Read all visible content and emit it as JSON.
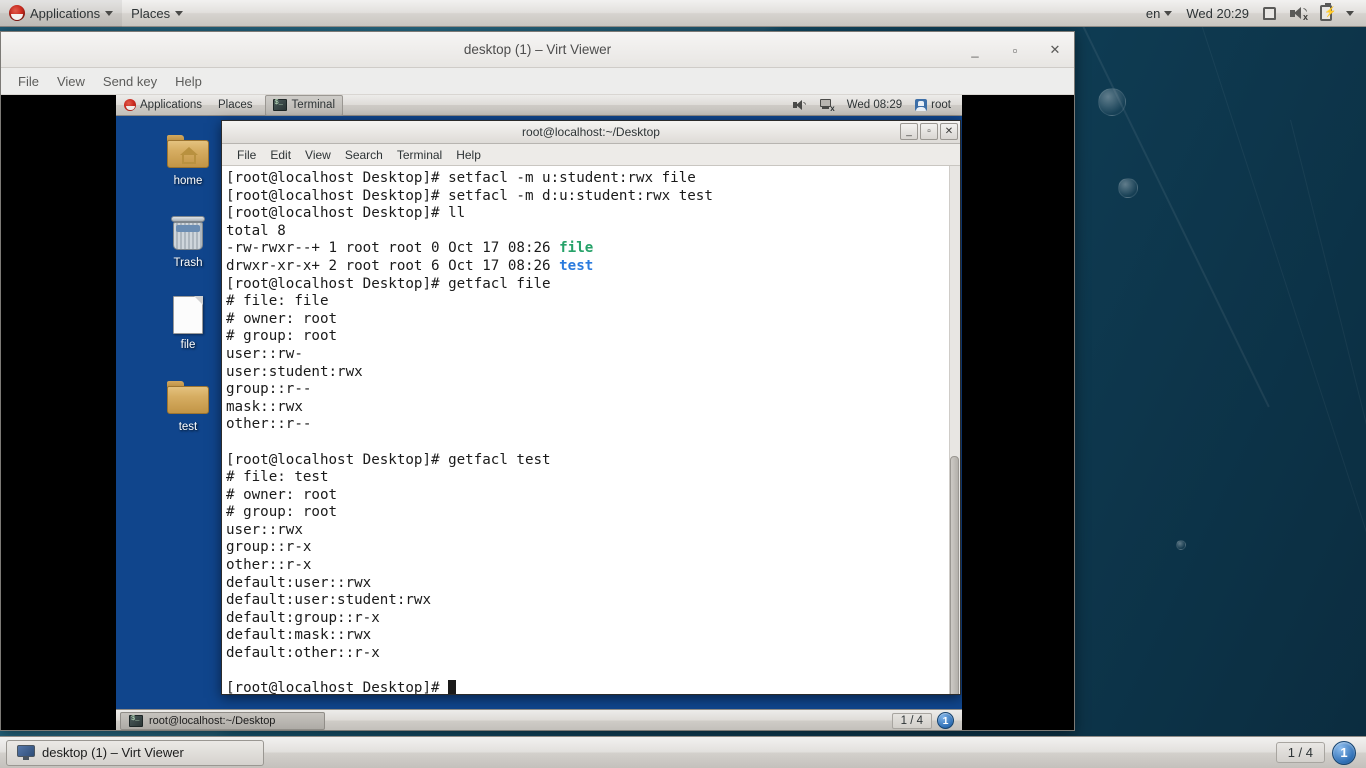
{
  "host": {
    "top_panel": {
      "applications_label": "Applications",
      "places_label": "Places",
      "keyboard_layout": "en",
      "clock": "Wed 20:29",
      "icons": [
        "screen-icon",
        "speaker-muted-icon",
        "battery-icon",
        "caret-down-icon"
      ]
    },
    "bottom_panel": {
      "task_label": "desktop (1) – Virt Viewer",
      "workspace_count": "1 / 4",
      "workspace_current": "1"
    }
  },
  "virt_viewer": {
    "title": "desktop (1) – Virt Viewer",
    "window_buttons": {
      "minimize": "_",
      "maximize": "▫",
      "close": "✕"
    },
    "menus": [
      "File",
      "View",
      "Send key",
      "Help"
    ]
  },
  "guest": {
    "top_panel": {
      "applications_label": "Applications",
      "places_label": "Places",
      "window_task": "Terminal",
      "clock": "Wed 08:29",
      "user": "root"
    },
    "desktop_icons": [
      {
        "name": "home",
        "label": "home",
        "icon": "home-folder-icon"
      },
      {
        "name": "trash",
        "label": "Trash",
        "icon": "trash-icon"
      },
      {
        "name": "file",
        "label": "file",
        "icon": "document-icon"
      },
      {
        "name": "test",
        "label": "test",
        "icon": "folder-icon"
      }
    ],
    "bottom_panel": {
      "task_label": "root@localhost:~/Desktop",
      "workspace_count": "1 / 4",
      "workspace_current": "1"
    }
  },
  "terminal": {
    "title": "root@localhost:~/Desktop",
    "window_buttons": {
      "minimize": "_",
      "maximize": "▫",
      "close": "✕"
    },
    "menus": [
      "File",
      "Edit",
      "View",
      "Search",
      "Terminal",
      "Help"
    ],
    "prompt": "[root@localhost Desktop]# ",
    "lines": [
      {
        "segments": [
          {
            "text": "[root@localhost Desktop]# setfacl -m u:student:rwx file"
          }
        ]
      },
      {
        "segments": [
          {
            "text": "[root@localhost Desktop]# setfacl -m d:u:student:rwx test"
          }
        ]
      },
      {
        "segments": [
          {
            "text": "[root@localhost Desktop]# ll"
          }
        ]
      },
      {
        "segments": [
          {
            "text": "total 8"
          }
        ]
      },
      {
        "segments": [
          {
            "text": "-rw-rwxr--+ 1 root root 0 Oct 17 08:26 "
          },
          {
            "text": "file",
            "color": "green"
          }
        ]
      },
      {
        "segments": [
          {
            "text": "drwxr-xr-x+ 2 root root 6 Oct 17 08:26 "
          },
          {
            "text": "test",
            "color": "blue"
          }
        ]
      },
      {
        "segments": [
          {
            "text": "[root@localhost Desktop]# getfacl file"
          }
        ]
      },
      {
        "segments": [
          {
            "text": "# file: file"
          }
        ]
      },
      {
        "segments": [
          {
            "text": "# owner: root"
          }
        ]
      },
      {
        "segments": [
          {
            "text": "# group: root"
          }
        ]
      },
      {
        "segments": [
          {
            "text": "user::rw-"
          }
        ]
      },
      {
        "segments": [
          {
            "text": "user:student:rwx"
          }
        ]
      },
      {
        "segments": [
          {
            "text": "group::r--"
          }
        ]
      },
      {
        "segments": [
          {
            "text": "mask::rwx"
          }
        ]
      },
      {
        "segments": [
          {
            "text": "other::r--"
          }
        ]
      },
      {
        "segments": [
          {
            "text": ""
          }
        ]
      },
      {
        "segments": [
          {
            "text": "[root@localhost Desktop]# getfacl test"
          }
        ]
      },
      {
        "segments": [
          {
            "text": "# file: test"
          }
        ]
      },
      {
        "segments": [
          {
            "text": "# owner: root"
          }
        ]
      },
      {
        "segments": [
          {
            "text": "# group: root"
          }
        ]
      },
      {
        "segments": [
          {
            "text": "user::rwx"
          }
        ]
      },
      {
        "segments": [
          {
            "text": "group::r-x"
          }
        ]
      },
      {
        "segments": [
          {
            "text": "other::r-x"
          }
        ]
      },
      {
        "segments": [
          {
            "text": "default:user::rwx"
          }
        ]
      },
      {
        "segments": [
          {
            "text": "default:user:student:rwx"
          }
        ]
      },
      {
        "segments": [
          {
            "text": "default:group::r-x"
          }
        ]
      },
      {
        "segments": [
          {
            "text": "default:mask::rwx"
          }
        ]
      },
      {
        "segments": [
          {
            "text": "default:other::r-x"
          }
        ]
      },
      {
        "segments": [
          {
            "text": ""
          }
        ]
      },
      {
        "segments": [
          {
            "text": "[root@localhost Desktop]# "
          },
          {
            "cursor": true
          }
        ]
      }
    ]
  },
  "colors": {
    "guest_desktop_bg": "#10458c",
    "terminal_fg": "#1a1a1a",
    "terminal_bg": "#ffffff",
    "green": "#26a269",
    "blue": "#2a7bde",
    "accent": "#2f6fb5"
  }
}
